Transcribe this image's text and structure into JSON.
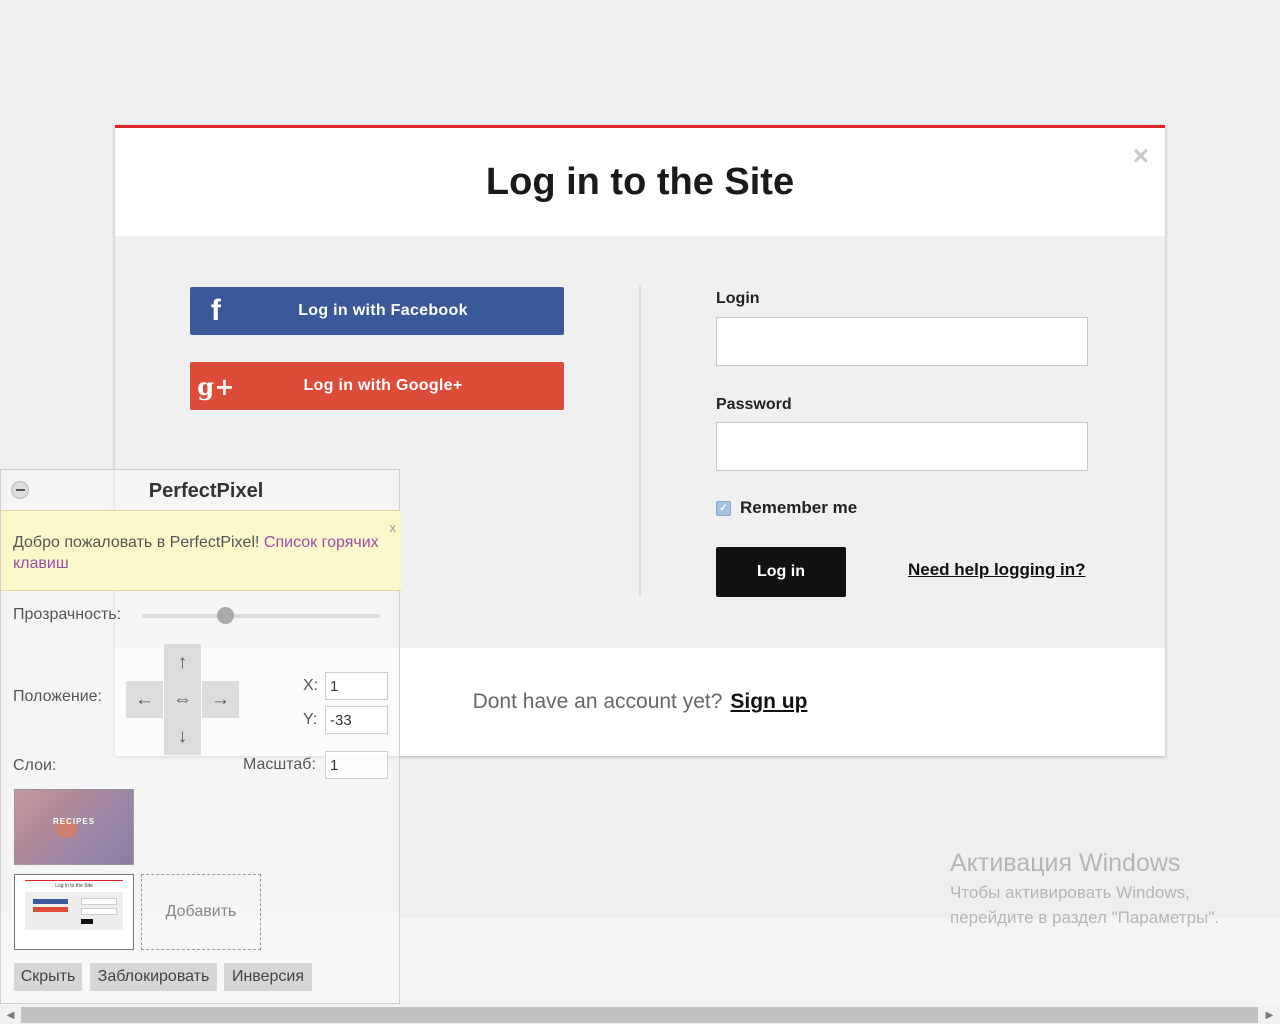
{
  "modal": {
    "title": "Log in to the Site",
    "close": "×",
    "facebook_button": "Log in with Facebook",
    "facebook_icon": "f",
    "google_button": "Log in with Google+",
    "google_icon": "g+",
    "login_label": "Login",
    "login_value": "",
    "password_label": "Password",
    "password_value": "",
    "remember_label": "Remember me",
    "remember_checked": true,
    "login_button": "Log in",
    "help_link": "Need help logging in?",
    "signup_text": "Dont have an account yet?",
    "signup_link": "Sign up",
    "accent_color": "#e0262b",
    "facebook_color": "#3b5998",
    "google_color": "#dd4b39"
  },
  "perfectpixel": {
    "title": "PerfectPixel",
    "notice_text": "Добро пожаловать в PerfectPixel!",
    "notice_link": "Список горячих клавиш",
    "notice_close": "x",
    "opacity_label": "Прозрачность:",
    "opacity_value": 0.35,
    "position_label": "Положение:",
    "arrows": {
      "up": "↑",
      "down": "↓",
      "left": "←",
      "right": "→",
      "center": "⇔"
    },
    "x_label": "X:",
    "x_value": "1",
    "y_label": "Y:",
    "y_value": "-33",
    "layers_label": "Слои:",
    "scale_label": "Масштаб:",
    "scale_value": "1",
    "layer1_caption": "RECIPES",
    "layer2_caption": "Log in to the Site",
    "add_label": "Добавить",
    "hide_button": "Скрыть",
    "lock_button": "Заблокировать",
    "invert_button": "Инверсия"
  },
  "watermark": {
    "title": "Активация Windows",
    "line1": "Чтобы активировать Windows,",
    "line2": "перейдите в раздел \"Параметры\"."
  },
  "scrollbar": {
    "left_arrow": "◀",
    "right_arrow": "▶"
  }
}
